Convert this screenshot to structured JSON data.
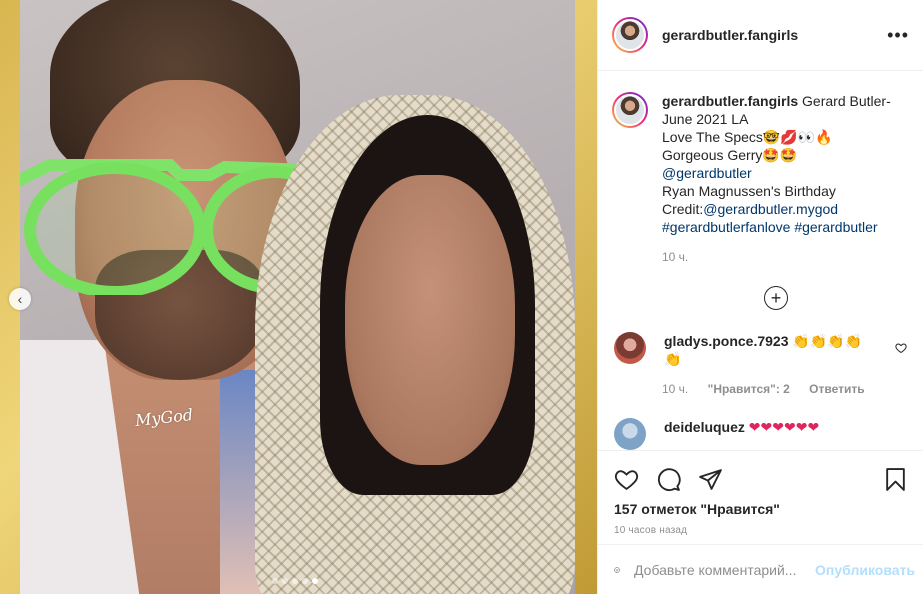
{
  "post": {
    "username": "gerardbutler.fangirls",
    "photo_watermark": "MyGod",
    "slides_total": 5,
    "slide_active": 5
  },
  "caption": {
    "username": "gerardbutler.fangirls",
    "line1": "Gerard Butler-",
    "line2": "June 2021 LA",
    "line3": "Love The Specs🤓💋👀🔥",
    "line4": "Gorgeous Gerry🤩🤩",
    "mention1": "@gerardbutler",
    "line6": "Ryan Magnussen's Birthday",
    "credit_label": "Credit:",
    "credit_mention": "@gerardbutler.mygod",
    "hashtag1": "#gerardbutlerfanlove",
    "hashtag2": "#gerardbutler",
    "time": "10 ч."
  },
  "load_more_icon": "plus-circle-icon",
  "comments": [
    {
      "username": "gladys.ponce.7923",
      "text": "👏👏👏👏👏",
      "time": "10 ч.",
      "likes": "\"Нравится\": 2",
      "reply": "Ответить"
    },
    {
      "username": "deideluquez",
      "text": "❤❤❤❤❤❤"
    }
  ],
  "actions": {
    "likes_count": "157 отметок \"Нравится\"",
    "timestamp": "10 часов назад"
  },
  "add_comment": {
    "placeholder": "Добавьте комментарий...",
    "publish_label": "Опубликовать"
  },
  "colors": {
    "link": "#00376b",
    "publish": "#b2dffc",
    "muted": "#8e8e8e"
  }
}
